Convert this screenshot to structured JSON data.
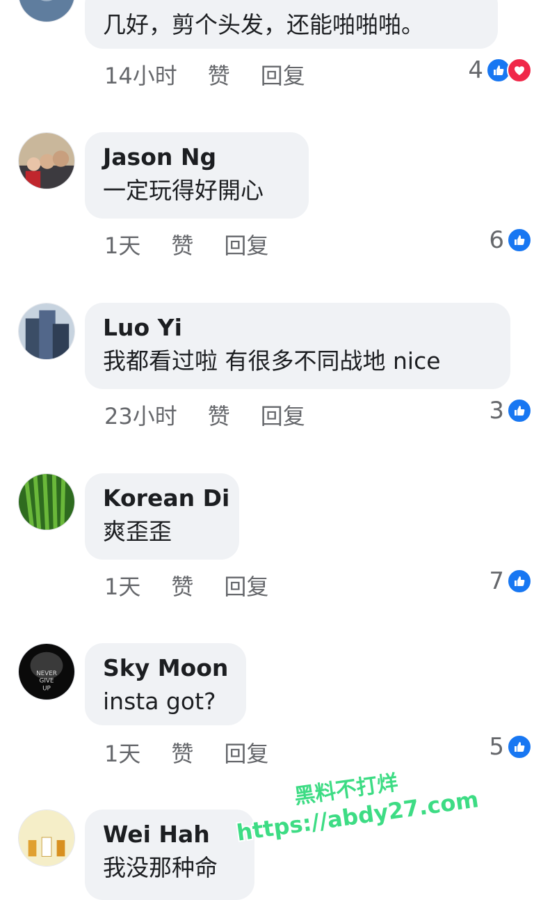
{
  "actions": {
    "like_label": "赞",
    "reply_label": "回复"
  },
  "colors": {
    "like_blue": "#1877f2",
    "love_red": "#f02849",
    "bubble_bg": "#f0f2f5",
    "watermark_green": "#3ddc84"
  },
  "comments": [
    {
      "author": "",
      "text": "几好，剪个头发，还能啪啪啪。",
      "time": "14小时",
      "count": "4",
      "reactions": [
        "like-icon",
        "love-icon"
      ]
    },
    {
      "author": "Jason Ng",
      "text": "一定玩得好開心",
      "time": "1天",
      "count": "6",
      "reactions": [
        "like-icon"
      ]
    },
    {
      "author": "Luo Yi",
      "text": "我都看过啦 有很多不同战地 nice",
      "time": "23小时",
      "count": "3",
      "reactions": [
        "like-icon"
      ]
    },
    {
      "author": "Korean Di",
      "text": "爽歪歪",
      "time": "1天",
      "count": "7",
      "reactions": [
        "like-icon"
      ]
    },
    {
      "author": "Sky Moon",
      "text": "insta got?",
      "time": "1天",
      "count": "5",
      "reactions": [
        "like-icon"
      ]
    },
    {
      "author": "Wei Hah",
      "text": "我没那种命",
      "time": "",
      "count": "",
      "reactions": []
    }
  ],
  "avatar_texts": {
    "sky_moon": [
      "NEVER",
      "GIVE",
      "UP"
    ]
  },
  "watermark": {
    "line1": "黑料不打烊",
    "line2": "https://abdy27.com"
  }
}
